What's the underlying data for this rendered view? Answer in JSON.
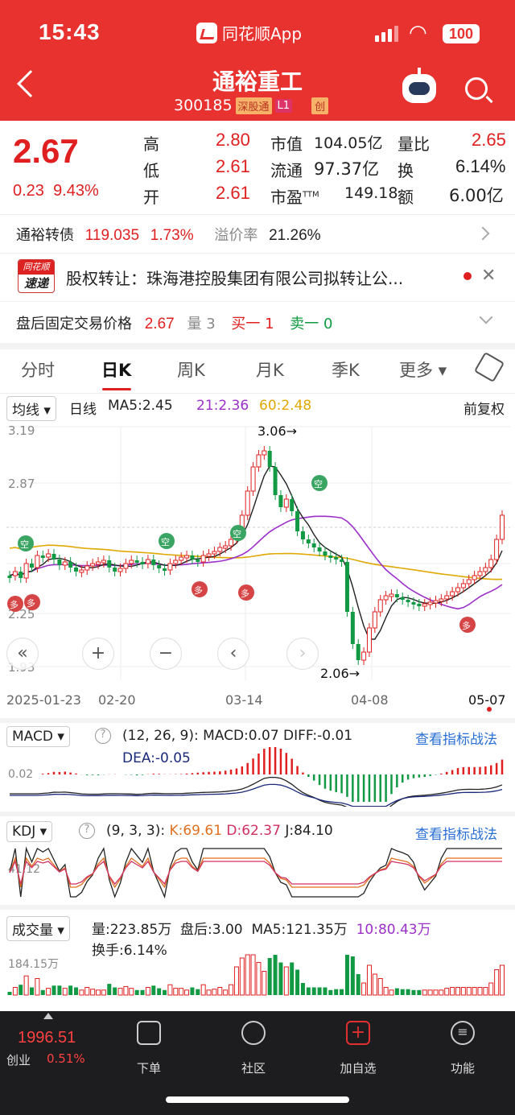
{
  "status_bar": {
    "time": "15:43",
    "app_name": "同花顺App",
    "battery": "100"
  },
  "header": {
    "title": "通裕重工",
    "code": "300185",
    "tag_market": "深股通",
    "tag_level": "L1",
    "tag_type": "创"
  },
  "quote": {
    "price": "2.67",
    "change": "0.23",
    "change_pct": "9.43%",
    "high_label": "高",
    "high": "2.80",
    "low_label": "低",
    "low": "2.61",
    "open_label": "开",
    "open": "2.61",
    "mcap_label": "市值",
    "mcap": "104.05亿",
    "float_label": "流通",
    "float": "97.37亿",
    "pe_label": "市盈",
    "pe_sup": "TTM",
    "pe": "149.18",
    "vr_label": "量比",
    "vr": "2.65",
    "turn_label": "换",
    "turn": "6.14%",
    "amt_label": "额",
    "amt": "6.00亿"
  },
  "bond": {
    "name": "通裕转债",
    "price": "119.035",
    "pct": "1.73%",
    "premium_label": "溢价率",
    "premium": "21.26%"
  },
  "news": {
    "logo_top": "同花顺",
    "logo_bottom": "速递",
    "text": "股权转让：珠海港控股集团有限公司拟转让公..."
  },
  "after_hours": {
    "label": "盘后固定交易价格",
    "price": "2.67",
    "vol_label": "量",
    "vol": "3",
    "buy": "买一 1",
    "sell": "卖一 0"
  },
  "tabs": [
    "分时",
    "日K",
    "周K",
    "月K",
    "季K",
    "更多"
  ],
  "kline": {
    "type_chip": "均线",
    "period": "日线",
    "ma5": "MA5:2.45",
    "ma21": "21:2.36",
    "ma60": "60:2.48",
    "adjust": "前复权",
    "y_ticks": [
      "3.19",
      "2.87",
      "2.25",
      "1.93"
    ],
    "x_ticks": [
      "2025-01-23",
      "02-20",
      "03-14",
      "04-08",
      "05-07"
    ],
    "high_mark": "3.06",
    "low_mark": "2.06",
    "colors": {
      "up": "#e02020",
      "down": "#119944",
      "ma5": "#222222",
      "ma21": "#9b30c8",
      "ma60": "#e0a800"
    }
  },
  "macd": {
    "chip": "MACD",
    "params": "(12, 26, 9):",
    "macd": "MACD:0.07",
    "diff": "DIFF:-0.01",
    "dea": "DEA:-0.05",
    "tick": "0.02",
    "link": "查看指标战法"
  },
  "kdj": {
    "chip": "KDJ",
    "params": "(9, 3, 3):",
    "k": "K:69.61",
    "d": "D:62.37",
    "j": "J:84.10",
    "tick": "41.12",
    "link": "查看指标战法"
  },
  "volume": {
    "chip": "成交量",
    "vol": "量:223.85万",
    "after": "盘后:3.00",
    "ma5": "MA5:121.35万",
    "ma10": "10:80.43万",
    "turn": "换手:6.14%",
    "tick": "184.15万"
  },
  "bottom_nav": {
    "index_value": "1996.51",
    "index_name": "创业",
    "index_pct": "0.51%",
    "items": [
      "下单",
      "社区",
      "加自选",
      "功能"
    ]
  }
}
